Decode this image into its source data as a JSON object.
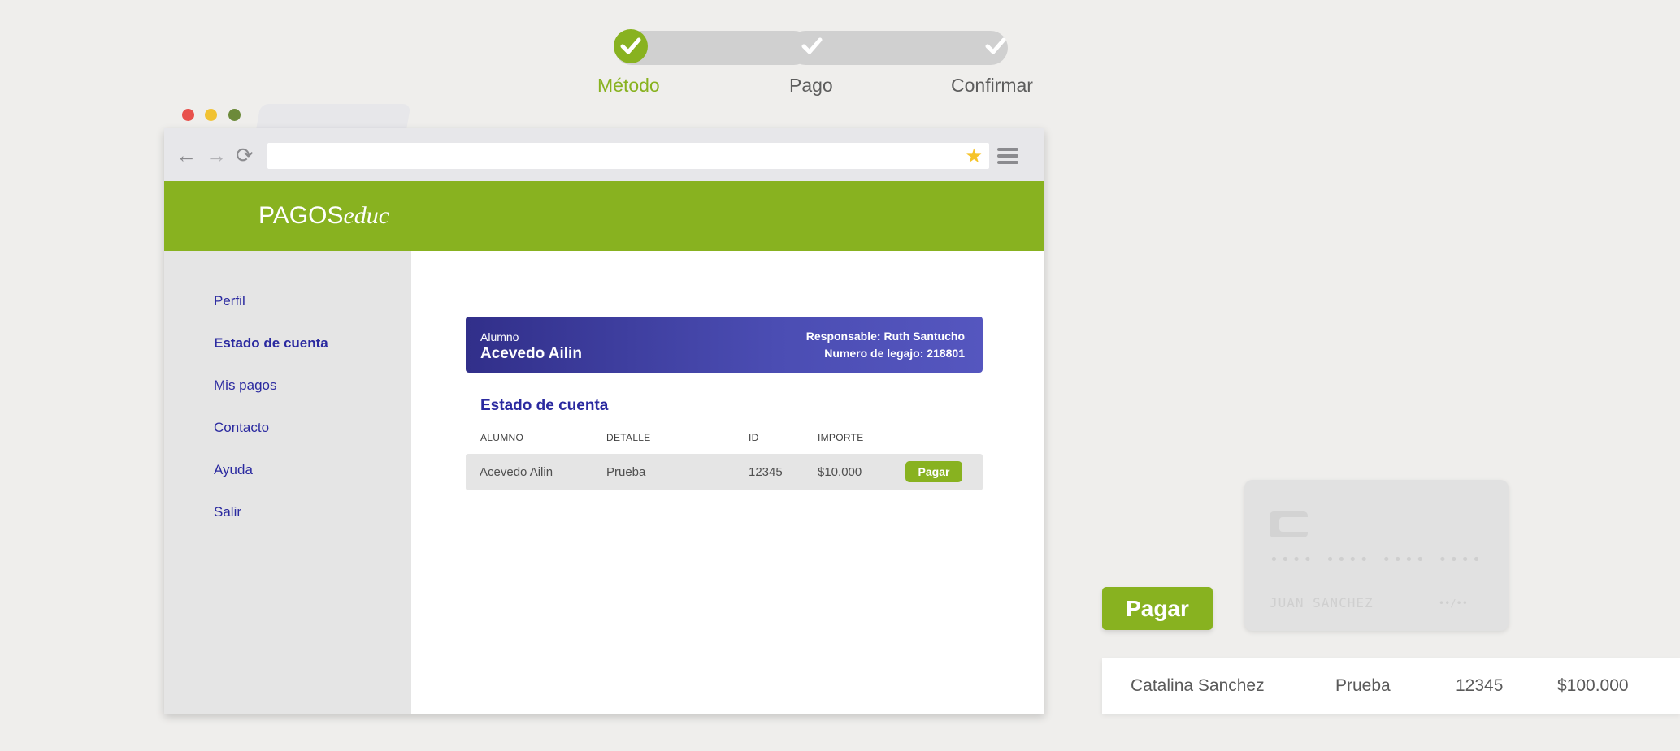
{
  "stepper": {
    "steps": [
      {
        "label": "Método",
        "state": "active"
      },
      {
        "label": "Pago",
        "state": "done"
      },
      {
        "label": "Confirmar",
        "state": "done"
      }
    ],
    "accent_color": "#88b220"
  },
  "browser": {
    "dots_colors": [
      "#e8514c",
      "#f1c232",
      "#6c8a3a"
    ],
    "address_value": "",
    "icons": [
      "back-arrow-icon",
      "forward-arrow-icon",
      "reload-icon",
      "star-icon",
      "menu-icon"
    ]
  },
  "app": {
    "logo_bold": "PAGOS",
    "logo_italic": "educ",
    "brand_color": "#88b220",
    "sidebar": {
      "items": [
        {
          "label": "Perfil",
          "active": false
        },
        {
          "label": "Estado de cuenta",
          "active": true
        },
        {
          "label": "Mis pagos",
          "active": false
        },
        {
          "label": "Contacto",
          "active": false
        },
        {
          "label": "Ayuda",
          "active": false
        },
        {
          "label": "Salir",
          "active": false
        }
      ]
    },
    "student_card": {
      "label": "Alumno",
      "name": "Acevedo Ailin",
      "responsable": "Responsable: Ruth Santucho",
      "legajo": "Numero de legajo: 218801"
    },
    "section_title": "Estado de cuenta",
    "table": {
      "headers": [
        "ALUMNO",
        "DETALLE",
        "ID",
        "IMPORTE"
      ],
      "rows": [
        {
          "alumno": "Acevedo Ailin",
          "detalle": "Prueba",
          "id": "12345",
          "importe": "$10.000",
          "action": "Pagar"
        }
      ]
    }
  },
  "decor": {
    "pay_button": "Pagar",
    "card": {
      "number": "•••• •••• •••• ••••",
      "holder": "JUAN SANCHEZ",
      "expiry": "••/••"
    },
    "row": {
      "name": "Catalina Sanchez",
      "detalle": "Prueba",
      "id": "12345",
      "importe": "$100.000"
    }
  }
}
